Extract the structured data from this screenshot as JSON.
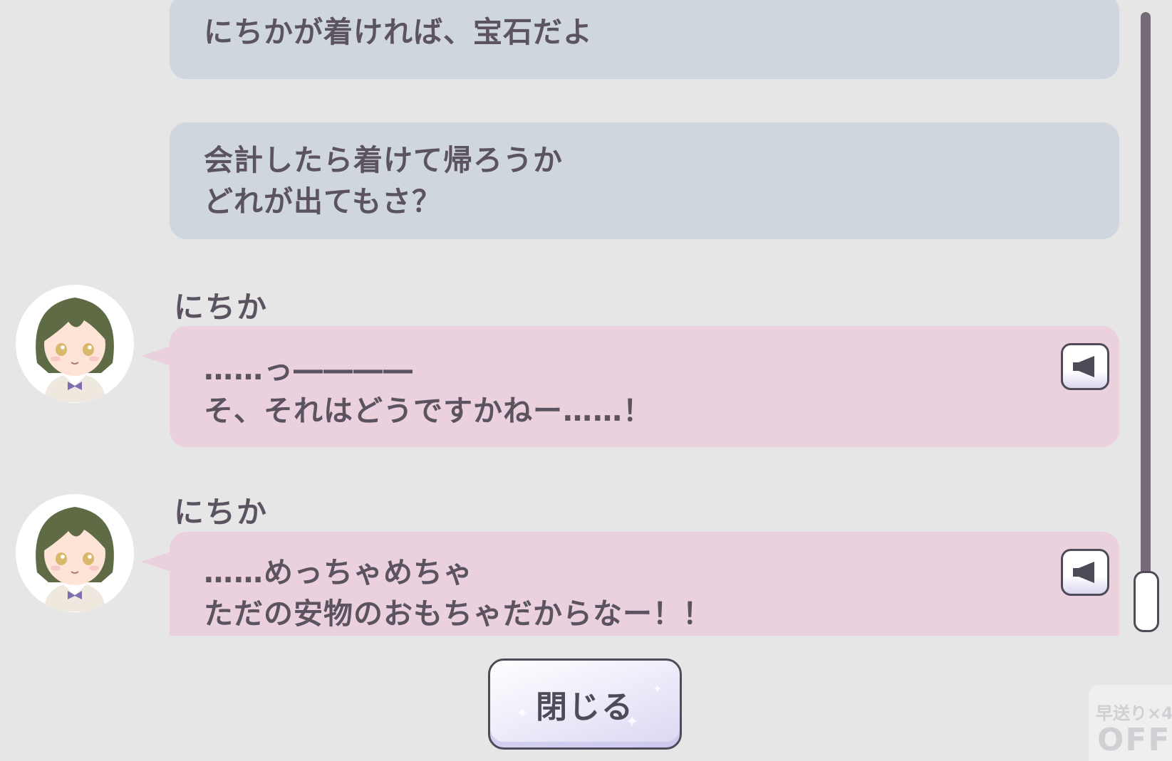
{
  "messages": [
    {
      "type": "narration",
      "lines": [
        "にちかが着ければ、宝石だよ"
      ]
    },
    {
      "type": "narration",
      "lines": [
        "会計したら着けて帰ろうか",
        "どれが出てもさ？"
      ]
    },
    {
      "type": "character",
      "speaker": "にちか",
      "lines": [
        "……っ――――",
        "そ、それはどうですかねー……！"
      ]
    },
    {
      "type": "character",
      "speaker": "にちか",
      "lines": [
        "……めっちゃめちゃ",
        "ただの安物のおもちゃだからなー！！"
      ]
    }
  ],
  "buttons": {
    "close_label": "閉じる",
    "voice_icon": "speaker-icon"
  },
  "fastforward": {
    "label": "早送り×4",
    "state": "OFF"
  },
  "scroll": {
    "position": 1.0
  },
  "colors": {
    "background": "#e6e6e6",
    "narration_bubble": "#cfd6de",
    "character_bubble": "#ebd1de",
    "text": "#5b5360",
    "accent_dark": "#4e4a57",
    "scroll_track": "#756b78"
  }
}
